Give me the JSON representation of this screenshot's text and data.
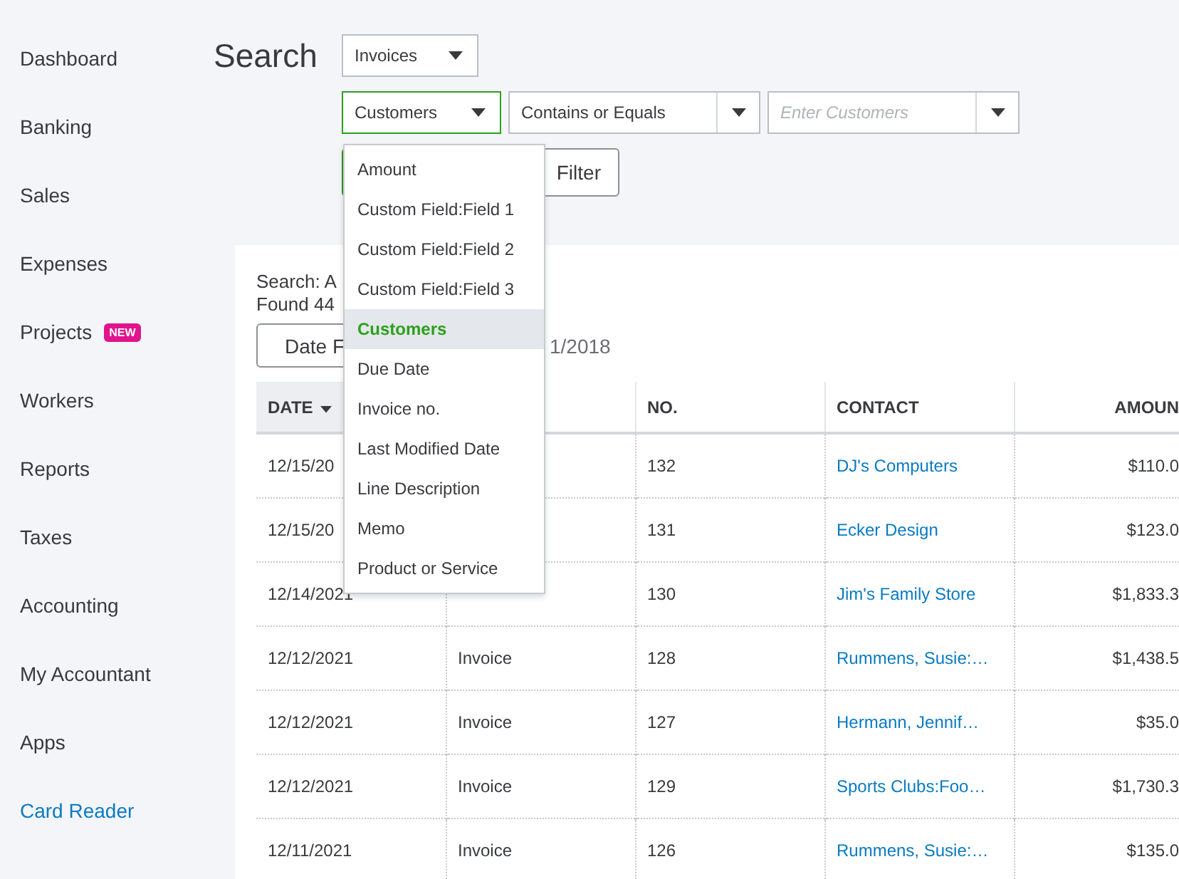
{
  "sidebar": {
    "items": [
      {
        "label": "Dashboard",
        "kind": "item"
      },
      {
        "label": "Banking",
        "kind": "item"
      },
      {
        "label": "Sales",
        "kind": "item"
      },
      {
        "label": "Expenses",
        "kind": "item"
      },
      {
        "label": "Projects",
        "kind": "item",
        "badge": "NEW"
      },
      {
        "label": "Workers",
        "kind": "item"
      },
      {
        "label": "Reports",
        "kind": "item"
      },
      {
        "label": "Taxes",
        "kind": "item"
      },
      {
        "label": "Accounting",
        "kind": "item"
      },
      {
        "label": "My Accountant",
        "kind": "item"
      },
      {
        "label": "Apps",
        "kind": "item"
      },
      {
        "label": "Card Reader",
        "kind": "link"
      }
    ]
  },
  "page_title": "Search",
  "type_select": {
    "value": "Invoices"
  },
  "filter_row": {
    "field_select": {
      "value": "Customers",
      "focused": true
    },
    "operator_select": {
      "value": "Contains or Equals"
    },
    "value_input": {
      "placeholder": "Enter Customers"
    }
  },
  "filter_button": "Filter",
  "field_menu": {
    "items": [
      {
        "label": "Amount",
        "selected": false
      },
      {
        "label": "Custom Field:Field 1",
        "selected": false
      },
      {
        "label": "Custom Field:Field 2",
        "selected": false
      },
      {
        "label": "Custom Field:Field 3",
        "selected": false
      },
      {
        "label": "Customers",
        "selected": true
      },
      {
        "label": "Due Date",
        "selected": false
      },
      {
        "label": "Invoice no.",
        "selected": false
      },
      {
        "label": "Last Modified Date",
        "selected": false
      },
      {
        "label": "Line Description",
        "selected": false
      },
      {
        "label": "Memo",
        "selected": false
      },
      {
        "label": "Product or Service",
        "selected": false
      }
    ]
  },
  "results": {
    "summary_line_1": "Search: A",
    "summary_line_2": "Found 44",
    "date_button": "Date F",
    "date_text": "1/2018",
    "table": {
      "columns": [
        {
          "label": "DATE",
          "sorted": true
        },
        {
          "sorted": false
        },
        {
          "label": "NO.",
          "sorted": false
        },
        {
          "label": "CONTACT",
          "sorted": false
        },
        {
          "label": "AMOUN",
          "sorted": false
        }
      ],
      "rows": [
        [
          "12/15/20",
          "",
          "132",
          "DJ's Computers",
          "$110.0"
        ],
        [
          "12/15/20",
          "",
          "131",
          "Ecker Design",
          "$123.0"
        ],
        [
          "12/14/2021",
          "",
          "130",
          "Jim's Family Store",
          "$1,833.3"
        ],
        [
          "12/12/2021",
          "Invoice",
          "128",
          "Rummens, Susie:…",
          "$1,438.5"
        ],
        [
          "12/12/2021",
          "Invoice",
          "127",
          "Hermann, Jennif…",
          "$35.0"
        ],
        [
          "12/12/2021",
          "Invoice",
          "129",
          "Sports Clubs:Foo…",
          "$1,730.3"
        ],
        [
          "12/11/2021",
          "Invoice",
          "126",
          "Rummens, Susie:…",
          "$135.0"
        ]
      ]
    }
  }
}
